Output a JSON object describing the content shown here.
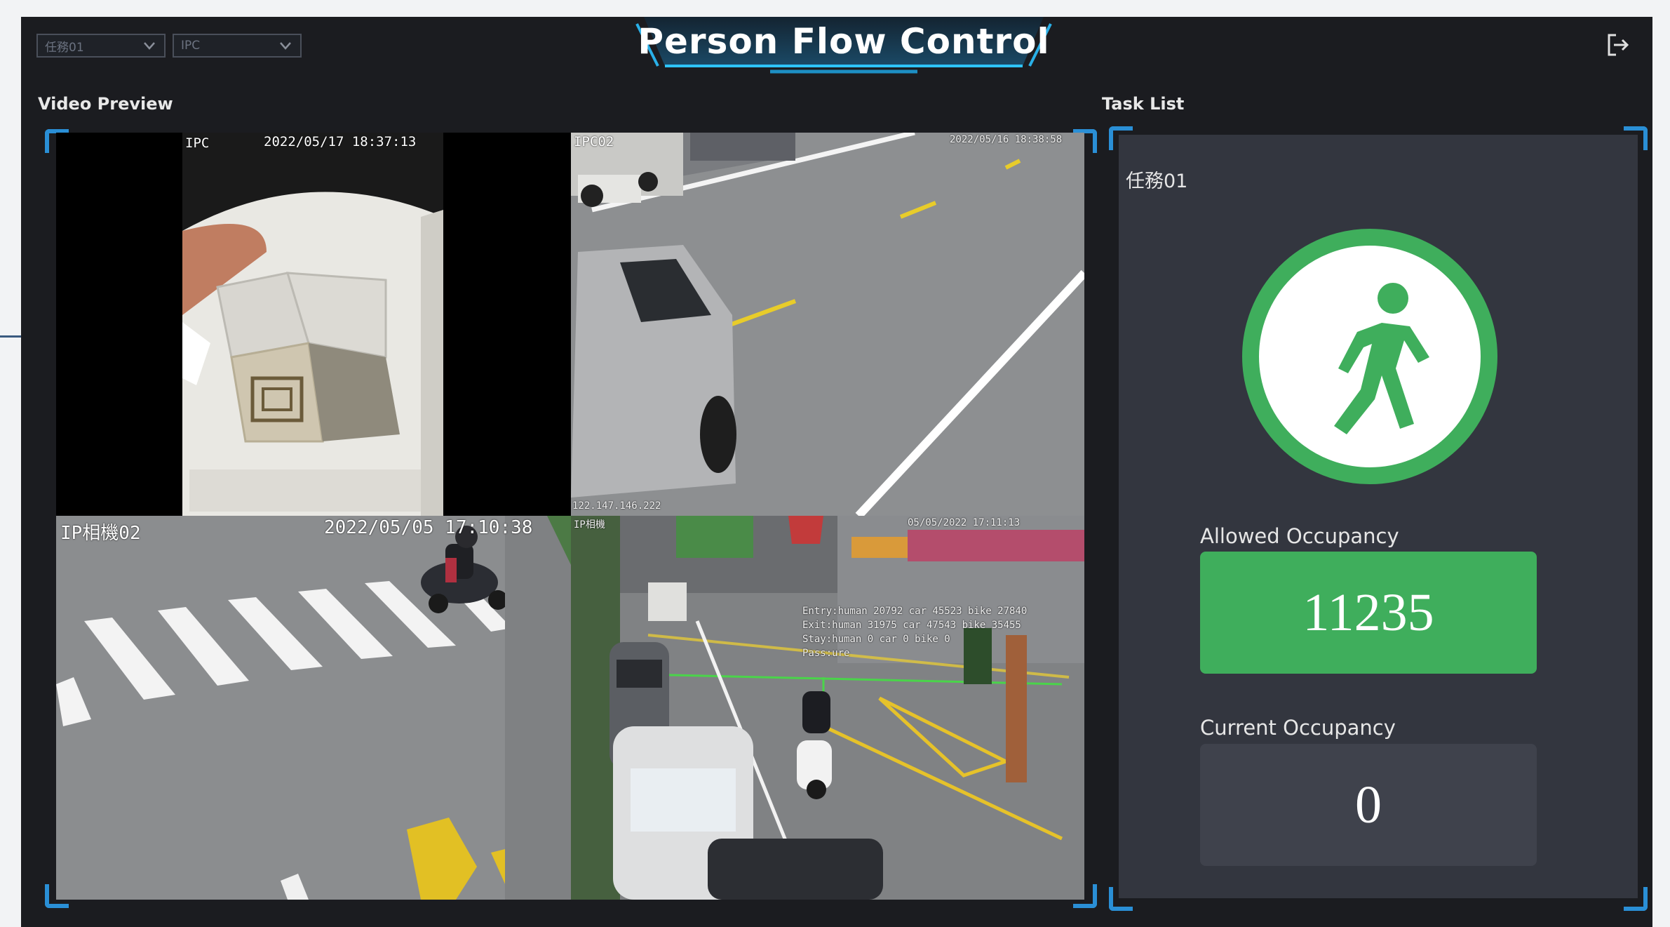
{
  "header": {
    "title": "Person Flow Control",
    "task_select": {
      "value": "任務01"
    },
    "camera_select": {
      "value": "IPC"
    },
    "logout_icon": "logout-icon"
  },
  "video_preview": {
    "label": "Video Preview",
    "tiles": [
      {
        "osd_name": "IPC",
        "osd_time": "2022/05/17 18:37:13"
      },
      {
        "osd_name": "IPC02",
        "osd_time": "2022/05/16 18:38:58",
        "osd_ip": "122.147.146.222"
      },
      {
        "osd_name": "IP相機02",
        "osd_time": "2022/05/05 17:10:38"
      },
      {
        "osd_name": "IP相機",
        "osd_time": "05/05/2022 17:11:13",
        "osd_counts": [
          "Entry:human 20792 car 45523 bike 27840",
          "Exit:human 31975 car 47543 bike 35455",
          "Stay:human 0 car 0 bike 0",
          "Pass:ure"
        ]
      }
    ]
  },
  "task_list": {
    "label": "Task List",
    "task_name": "任務01",
    "status_icon": "walking-person-icon",
    "allowed_label": "Allowed Occupancy",
    "allowed_value": "11235",
    "current_label": "Current Occupancy",
    "current_value": "0",
    "colors": {
      "status_green": "#3fae5c",
      "accent_blue": "#2a8fd6"
    }
  }
}
